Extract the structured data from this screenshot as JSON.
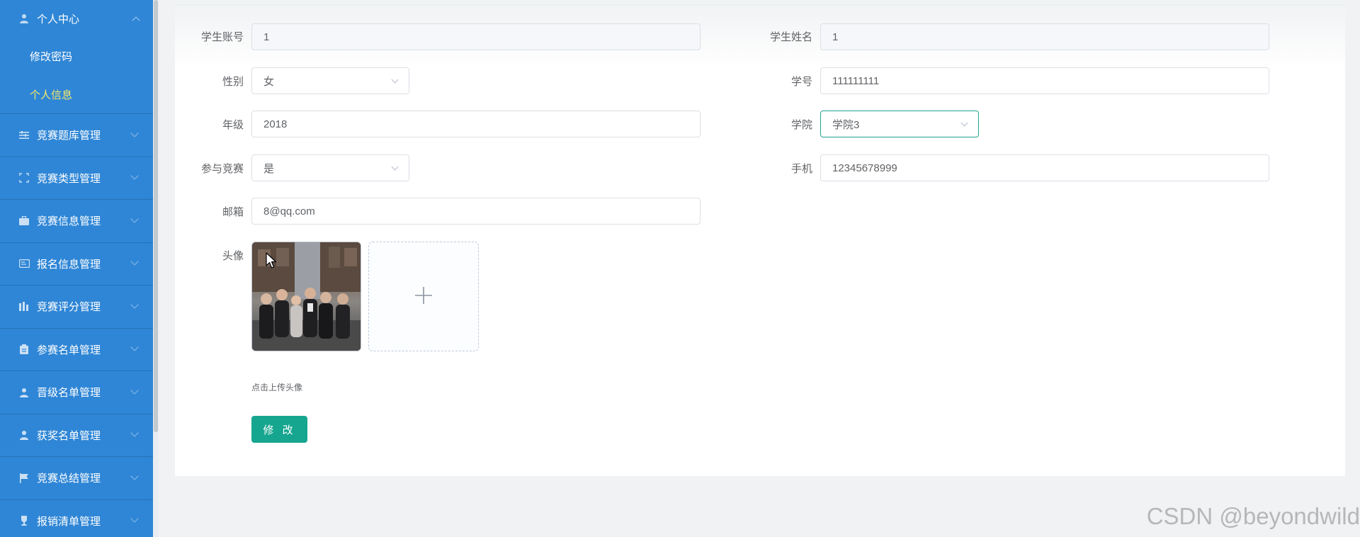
{
  "sidebar": {
    "header": {
      "label": "个人中心",
      "icon": "user-icon"
    },
    "submenu": [
      {
        "label": "修改密码"
      },
      {
        "label": "个人信息",
        "active": true
      }
    ],
    "items": [
      {
        "label": "竞赛题库管理",
        "icon": "list-icon"
      },
      {
        "label": "竞赛类型管理",
        "icon": "frame-icon"
      },
      {
        "label": "竞赛信息管理",
        "icon": "briefcase-icon"
      },
      {
        "label": "报名信息管理",
        "icon": "id-card-icon"
      },
      {
        "label": "竞赛评分管理",
        "icon": "bar-chart-icon"
      },
      {
        "label": "参赛名单管理",
        "icon": "clipboard-icon"
      },
      {
        "label": "晋级名单管理",
        "icon": "user-icon"
      },
      {
        "label": "获奖名单管理",
        "icon": "user-icon"
      },
      {
        "label": "竞赛总结管理",
        "icon": "flag-icon"
      },
      {
        "label": "报销清单管理",
        "icon": "trophy-icon"
      }
    ]
  },
  "form": {
    "student_account": {
      "label": "学生账号",
      "value": "1"
    },
    "student_name": {
      "label": "学生姓名",
      "value": "1"
    },
    "gender": {
      "label": "性别",
      "value": "女"
    },
    "student_number": {
      "label": "学号",
      "value": "111111111"
    },
    "grade": {
      "label": "年级",
      "value": "2018"
    },
    "college": {
      "label": "学院",
      "value": "学院3"
    },
    "participate": {
      "label": "参与竞赛",
      "value": "是"
    },
    "phone": {
      "label": "手机",
      "value": "12345678999"
    },
    "email": {
      "label": "邮箱",
      "value": "8@qq.com"
    },
    "avatar": {
      "label": "头像",
      "upload_tip": "点击上传头像"
    },
    "submit_label": "修 改"
  },
  "colors": {
    "sidebar_bg": "#2f86d6",
    "active_menu": "#f5e86a",
    "primary_button": "#16a68f",
    "focus_border": "#20a48f"
  },
  "watermark": "CSDN @beyondwild"
}
